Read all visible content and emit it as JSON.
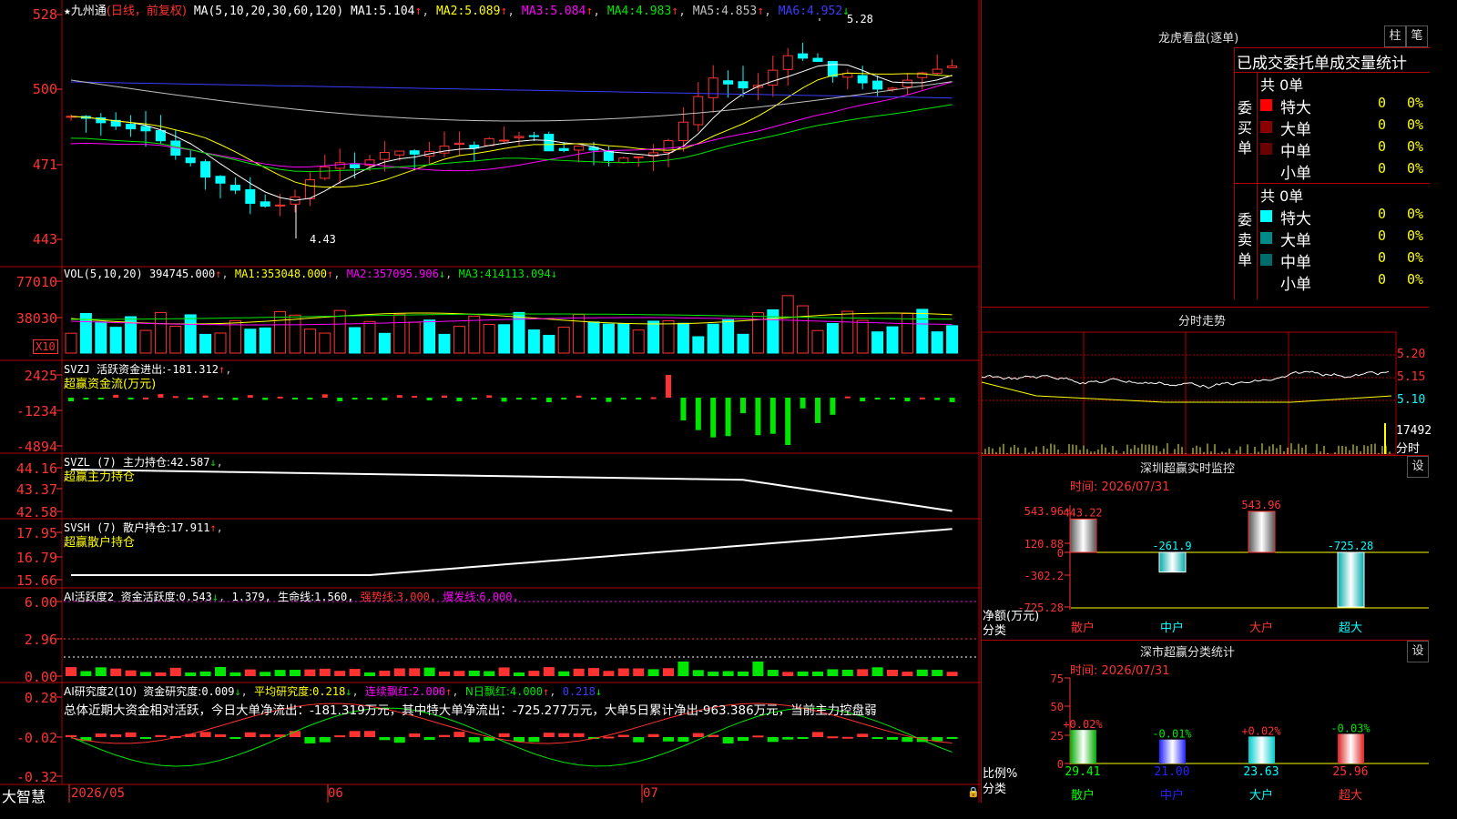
{
  "colors": {
    "up": "#ff3232",
    "down": "#00ffff",
    "bg": "#000000",
    "border": "#b00000"
  },
  "main": {
    "star": "★",
    "stock": "九州通",
    "period": "(日线，前复权)",
    "ma_header": "MA(5,10,20,30,60,120)",
    "ma": [
      {
        "label": "MA1:",
        "value": "5.104",
        "arrow": "↑"
      },
      {
        "label": "MA2:",
        "value": "5.089",
        "arrow": "↑"
      },
      {
        "label": "MA3:",
        "value": "5.084",
        "arrow": "↑"
      },
      {
        "label": "MA4:",
        "value": "4.983",
        "arrow": "↑"
      },
      {
        "label": "MA5:",
        "value": "4.853",
        "arrow": "↑"
      },
      {
        "label": "MA6:",
        "value": "4.952",
        "arrow": "↓"
      }
    ],
    "y_ticks": [
      "528",
      "500",
      "471",
      "443"
    ],
    "high_label": "5.28",
    "low_label": "4.43"
  },
  "vol": {
    "title": "VOL(5,10,20)",
    "value": "394745.000",
    "ma": [
      {
        "label": "MA1:",
        "value": "353048.000",
        "arrow": "↑"
      },
      {
        "label": "MA2:",
        "value": "357095.906",
        "arrow": "↓"
      },
      {
        "label": "MA3:",
        "value": "414113.094",
        "arrow": "↓"
      }
    ],
    "y_ticks": [
      "77010",
      "38030"
    ],
    "unit": "X10"
  },
  "svzj": {
    "title": "SVZJ",
    "desc": "活跃资金进出:",
    "value": "-181.312",
    "arrow": "↑",
    "sub": "超赢资金流(万元)",
    "y_ticks": [
      "2425",
      "-1234",
      "-4894"
    ]
  },
  "svzl": {
    "title": "SVZL (7)",
    "desc": "主力持仓:",
    "value": "42.587",
    "arrow": "↓",
    "sub": "超赢主力持仓",
    "y_ticks": [
      "44.16",
      "43.37",
      "42.58"
    ]
  },
  "svsh": {
    "title": "SVSH (7)",
    "desc": "散户持仓:",
    "value": "17.911",
    "arrow": "↑",
    "sub": "超赢散户持仓",
    "y_ticks": [
      "17.95",
      "16.79",
      "15.66"
    ]
  },
  "ai1": {
    "title": "AI活跃度2",
    "desc": "资金活跃度:",
    "v1": "0.543",
    "a1": "↓",
    "v2": "1.379,",
    "life": "生命线:",
    "life_v": "1.560,",
    "strong": "强势线:",
    "strong_v": "3.000,",
    "burst": "爆发线:",
    "burst_v": "6.000,",
    "y_ticks": [
      "6.00",
      "2.96",
      "0.00"
    ]
  },
  "ai2": {
    "title": "AI研究度2(10)",
    "desc": "资金研究度:",
    "v1": "0.009",
    "a1": "↓",
    "avg": "平均研究度:",
    "avg_v": "0.218",
    "a2": "↓",
    "lianxu": "连续飘红:",
    "lianxu_v": "2.000",
    "a3": "↑",
    "nday": "N日飘红:",
    "nday_v": "4.000",
    "a4": "↑",
    "v5": "0.218",
    "a5": "↓",
    "summary": "总体近期大资金相对活跃，今日大单净流出：-181.319万元，其中特大单净流出：-725.277万元，大单5日累计净出-963.386万元，当前主力控盘弱",
    "y_ticks": [
      "0.28",
      "-0.02",
      "-0.32"
    ]
  },
  "footer": {
    "brand": "大智慧",
    "dates": [
      "2026/05",
      "06",
      "07"
    ]
  },
  "lhb": {
    "title": "龙虎看盘(逐单)",
    "btn1": "柱",
    "btn2": "笔",
    "header": "已成交委托单成交量统计",
    "buy": {
      "side": "委买单",
      "count": "共 0单",
      "rows": [
        {
          "label": "特大",
          "v": "0",
          "p": "0%"
        },
        {
          "label": "大单",
          "v": "0",
          "p": "0%"
        },
        {
          "label": "中单",
          "v": "0",
          "p": "0%"
        },
        {
          "label": "小单",
          "v": "0",
          "p": "0%"
        }
      ]
    },
    "sell": {
      "side": "委卖单",
      "count": "共 0单",
      "rows": [
        {
          "label": "特大",
          "v": "0",
          "p": "0%"
        },
        {
          "label": "大单",
          "v": "0",
          "p": "0%"
        },
        {
          "label": "中单",
          "v": "0",
          "p": "0%"
        },
        {
          "label": "小单",
          "v": "0",
          "p": "0%"
        }
      ]
    }
  },
  "intraday": {
    "title": "分时走势",
    "ticks": [
      "5.20",
      "5.15",
      "5.10"
    ],
    "vol_label": "17492",
    "unit": "分时"
  },
  "sz_monitor": {
    "title": "深圳超赢实时监控",
    "btn": "设",
    "time": "时间: 2026/07/31",
    "y_ticks": [
      "543.96",
      "120.88",
      "0",
      "-302.2",
      "-725.28"
    ],
    "bars": [
      {
        "label": "散户",
        "value": "443.22"
      },
      {
        "label": "中户",
        "value": "-261.9"
      },
      {
        "label": "大户",
        "value": "543.96"
      },
      {
        "label": "超大",
        "value": "-725.28"
      }
    ],
    "left1": "净额(万元)",
    "left2": "分类"
  },
  "sz_stats": {
    "title": "深市超赢分类统计",
    "btn": "设",
    "time": "时间: 2026/07/31",
    "y_ticks": [
      "75",
      "50",
      "25",
      "0"
    ],
    "bars": [
      {
        "label": "散户",
        "pct": "+0.02%",
        "value": "29.41"
      },
      {
        "label": "中户",
        "pct": "-0.01%",
        "value": "21.00"
      },
      {
        "label": "大户",
        "pct": "+0.02%",
        "value": "23.63"
      },
      {
        "label": "超大",
        "pct": "-0.03%",
        "value": "25.96"
      }
    ],
    "left1": "比例%",
    "left2": "分类"
  }
}
